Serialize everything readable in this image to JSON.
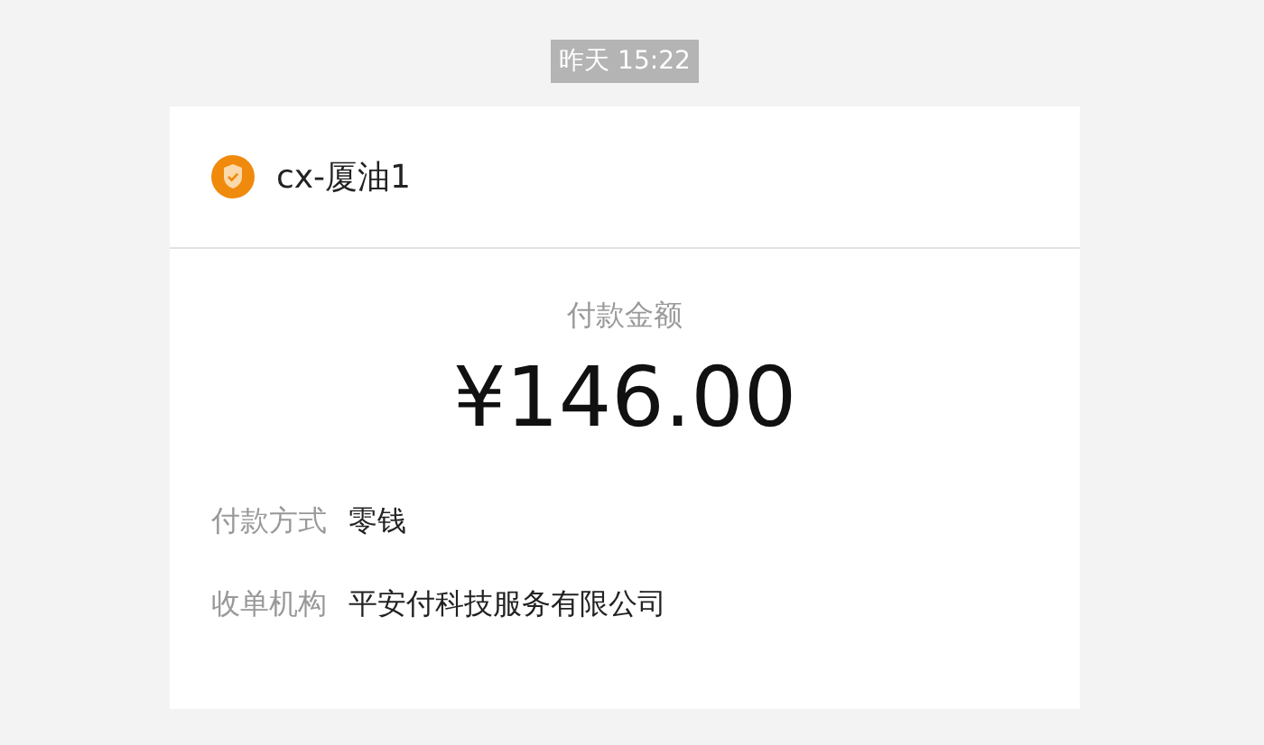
{
  "timestamp": "昨天 15:22",
  "card": {
    "merchant": "cx-厦油1",
    "amount_label": "付款金额",
    "amount": "¥146.00",
    "details": [
      {
        "label": "付款方式",
        "value": "零钱"
      },
      {
        "label": "收单机构",
        "value": "平安付科技服务有限公司"
      }
    ]
  }
}
